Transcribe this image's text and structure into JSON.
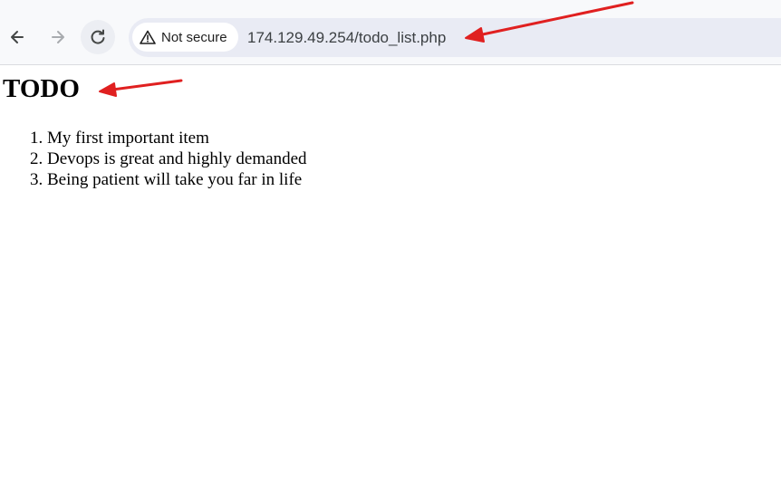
{
  "browser": {
    "security_label": "Not secure",
    "url": "174.129.49.254/todo_list.php",
    "icons": {
      "back": "back-arrow-icon",
      "forward": "forward-arrow-icon",
      "reload": "reload-icon",
      "warning": "warning-triangle-icon"
    }
  },
  "page": {
    "heading": "TODO",
    "items": [
      "My first important item",
      "Devops is great and highly demanded",
      "Being patient will take you far in life"
    ]
  },
  "annotations": {
    "arrow_color": "#e02020"
  }
}
